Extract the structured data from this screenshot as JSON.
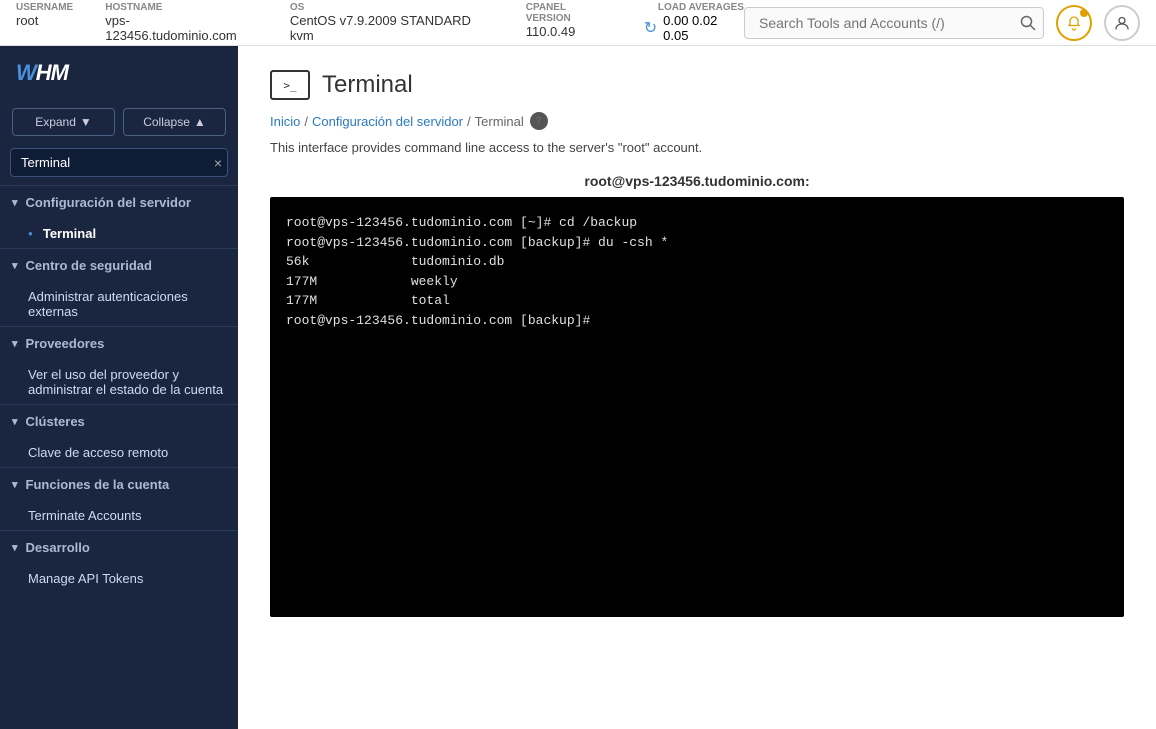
{
  "topbar": {
    "username_label": "Username",
    "username_value": "root",
    "hostname_label": "Hostname",
    "hostname_value": "vps-123456.tudominio.com",
    "os_label": "OS",
    "os_value": "CentOS v7.9.2009 STANDARD kvm",
    "cpanel_label": "cPanel Version",
    "cpanel_value": "110.0.49",
    "load_label": "Load Averages",
    "load_values": "0.00  0.02  0.05",
    "search_placeholder": "Search Tools and Accounts (/)"
  },
  "sidebar": {
    "logo": "WHM",
    "expand_label": "Expand",
    "collapse_label": "Collapse",
    "search_value": "Terminal",
    "search_clear": "×",
    "sections": [
      {
        "id": "configuracion-servidor",
        "label": "Configuración del servidor",
        "expanded": true,
        "items": [
          {
            "id": "terminal",
            "label": "Terminal",
            "active": true
          }
        ]
      },
      {
        "id": "centro-seguridad",
        "label": "Centro de seguridad",
        "expanded": true,
        "items": [
          {
            "id": "admin-auth",
            "label": "Administrar autenticaciones externas",
            "active": false
          }
        ]
      },
      {
        "id": "proveedores",
        "label": "Proveedores",
        "expanded": true,
        "items": [
          {
            "id": "ver-proveedor",
            "label": "Ver el uso del proveedor y administrar el estado de la cuenta",
            "active": false
          }
        ]
      },
      {
        "id": "clusteres",
        "label": "Clústeres",
        "expanded": true,
        "items": [
          {
            "id": "clave-acceso",
            "label": "Clave de acceso remoto",
            "active": false
          }
        ]
      },
      {
        "id": "funciones-cuenta",
        "label": "Funciones de la cuenta",
        "expanded": true,
        "items": [
          {
            "id": "terminate-accounts",
            "label": "Terminate Accounts",
            "active": false
          }
        ]
      },
      {
        "id": "desarrollo",
        "label": "Desarrollo",
        "expanded": true,
        "items": [
          {
            "id": "manage-api",
            "label": "Manage API Tokens",
            "active": false
          }
        ]
      }
    ]
  },
  "page": {
    "title": "Terminal",
    "breadcrumb_inicio": "Inicio",
    "breadcrumb_config": "Configuración del servidor",
    "breadcrumb_current": "Terminal",
    "description": "This interface provides command line access to the server's \"root\" account.",
    "terminal_title": "root@vps-123456.tudominio.com:",
    "terminal_content": "root@vps-123456.tudominio.com [~]# cd /backup\nroot@vps-123456.tudominio.com [backup]# du -csh *\n56k\t\ttudominio.db\n177M\t\tweekly\n177M\t\ttotal\nroot@vps-123456.tudominio.com [backup]# "
  }
}
